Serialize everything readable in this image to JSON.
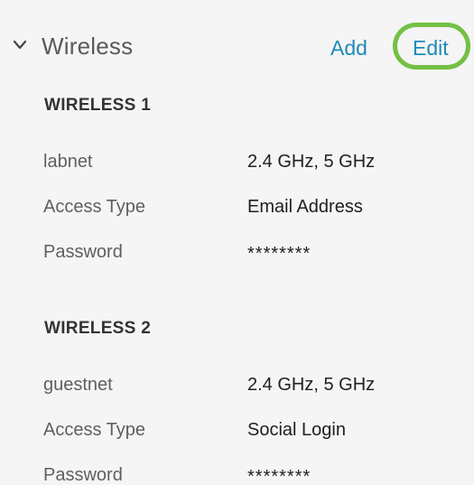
{
  "section": {
    "title": "Wireless",
    "add_label": "Add",
    "edit_label": "Edit"
  },
  "wireless1": {
    "title": "WIRELESS 1",
    "ssid": "labnet",
    "bands": "2.4 GHz, 5 GHz",
    "access_type_label": "Access Type",
    "access_type_value": "Email Address",
    "password_label": "Password",
    "password_value": "********"
  },
  "wireless2": {
    "title": "WIRELESS 2",
    "ssid": "guestnet",
    "bands": "2.4 GHz, 5 GHz",
    "access_type_label": "Access Type",
    "access_type_value": "Social Login",
    "password_label": "Password",
    "password_value": "********"
  },
  "colors": {
    "accent": "#1e8ab8",
    "highlight": "#74c045"
  },
  "icons": {
    "chevron": "chevron-down-icon"
  }
}
